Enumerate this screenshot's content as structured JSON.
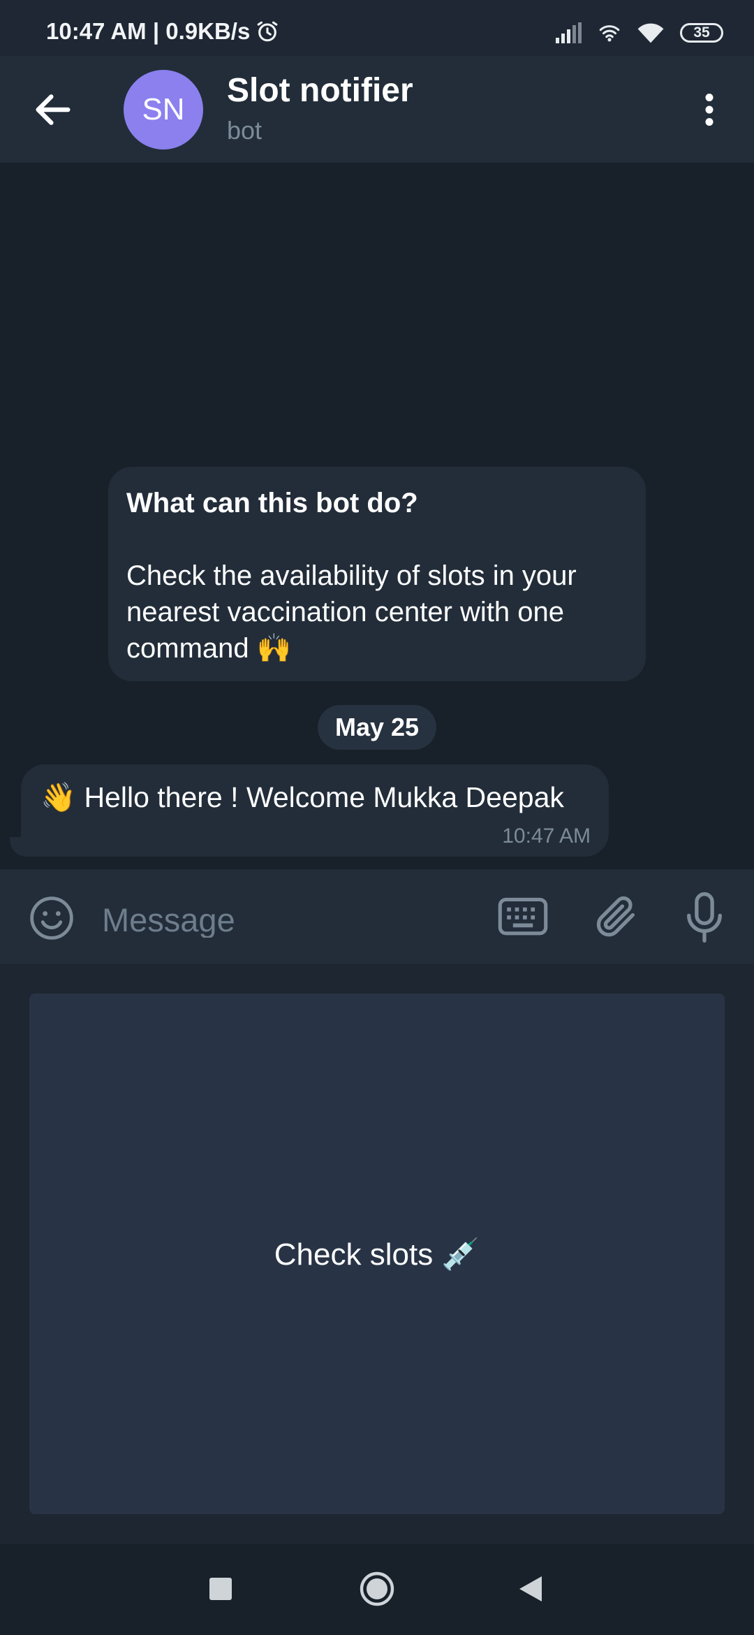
{
  "status_bar": {
    "time": "10:47 AM | 0.9KB/s",
    "battery": "35",
    "icons": [
      "alarm-icon",
      "signal-icon",
      "hotspot-icon",
      "wifi-icon",
      "battery-icon"
    ]
  },
  "header": {
    "avatar_initials": "SN",
    "avatar_color": "#8b80ee",
    "title": "Slot notifier",
    "subtitle": "bot"
  },
  "intro": {
    "title": "What can this bot do?",
    "body": "Check the availability of slots in your nearest vaccination center with one command 🙌"
  },
  "date_chip": "May 25",
  "messages": [
    {
      "text": "👋 Hello there ! Welcome Mukka Deepak",
      "time": "10:47 AM"
    }
  ],
  "composer": {
    "placeholder": "Message"
  },
  "bot_keyboard": {
    "buttons": [
      {
        "label": "Check slots 💉"
      }
    ]
  }
}
